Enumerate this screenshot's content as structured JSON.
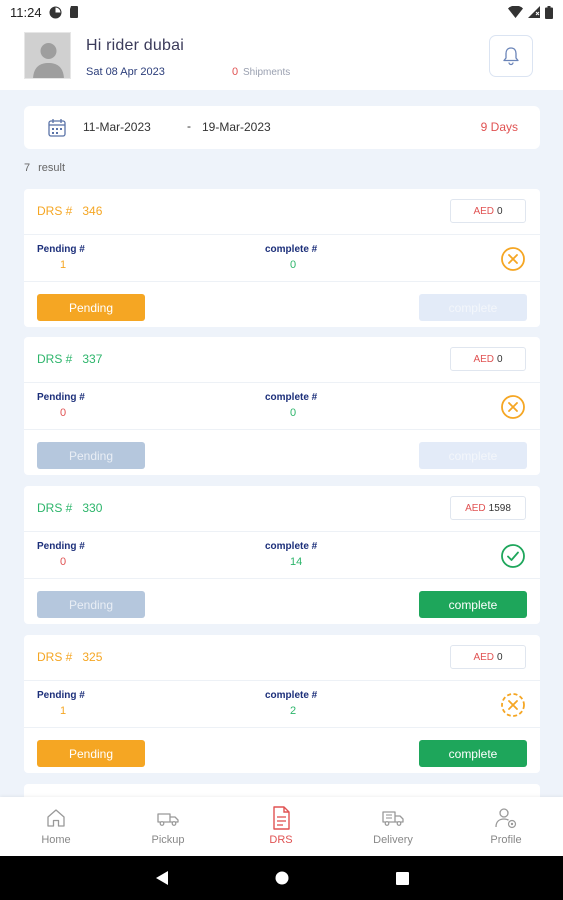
{
  "status_bar": {
    "time": "11:24"
  },
  "header": {
    "greeting": "Hi rider dubai",
    "date": "Sat 08 Apr 2023",
    "shipments_count": "0",
    "shipments_label": "Shipments"
  },
  "date_range": {
    "start": "11-Mar-2023",
    "separator": "-",
    "end": "19-Mar-2023",
    "days": "9 Days"
  },
  "results": {
    "count": "7",
    "label": "result"
  },
  "labels": {
    "drs": "DRS #",
    "aed": "AED",
    "pending_label": "Pending #",
    "complete_label": "complete #",
    "pending_button": "Pending",
    "complete_button": "complete"
  },
  "cards": [
    {
      "drs_number": "346",
      "aed_value": "0",
      "pending": "1",
      "complete": "0",
      "status": "cancel"
    },
    {
      "drs_number": "337",
      "aed_value": "0",
      "pending": "0",
      "complete": "0",
      "status": "cancel"
    },
    {
      "drs_number": "330",
      "aed_value": "1598",
      "pending": "0",
      "complete": "14",
      "status": "done"
    },
    {
      "drs_number": "325",
      "aed_value": "0",
      "pending": "1",
      "complete": "2",
      "status": "partial"
    }
  ],
  "nav": {
    "items": [
      {
        "label": "Home",
        "icon": "home-icon"
      },
      {
        "label": "Pickup",
        "icon": "pickup-truck-icon"
      },
      {
        "label": "DRS",
        "icon": "document-icon"
      },
      {
        "label": "Delivery",
        "icon": "delivery-truck-icon"
      },
      {
        "label": "Profile",
        "icon": "user-settings-icon"
      }
    ],
    "active": "DRS"
  },
  "colors": {
    "orange": "#f5a623",
    "green": "#1ea65b",
    "red": "#e05252",
    "navy": "#1c2f7a"
  }
}
